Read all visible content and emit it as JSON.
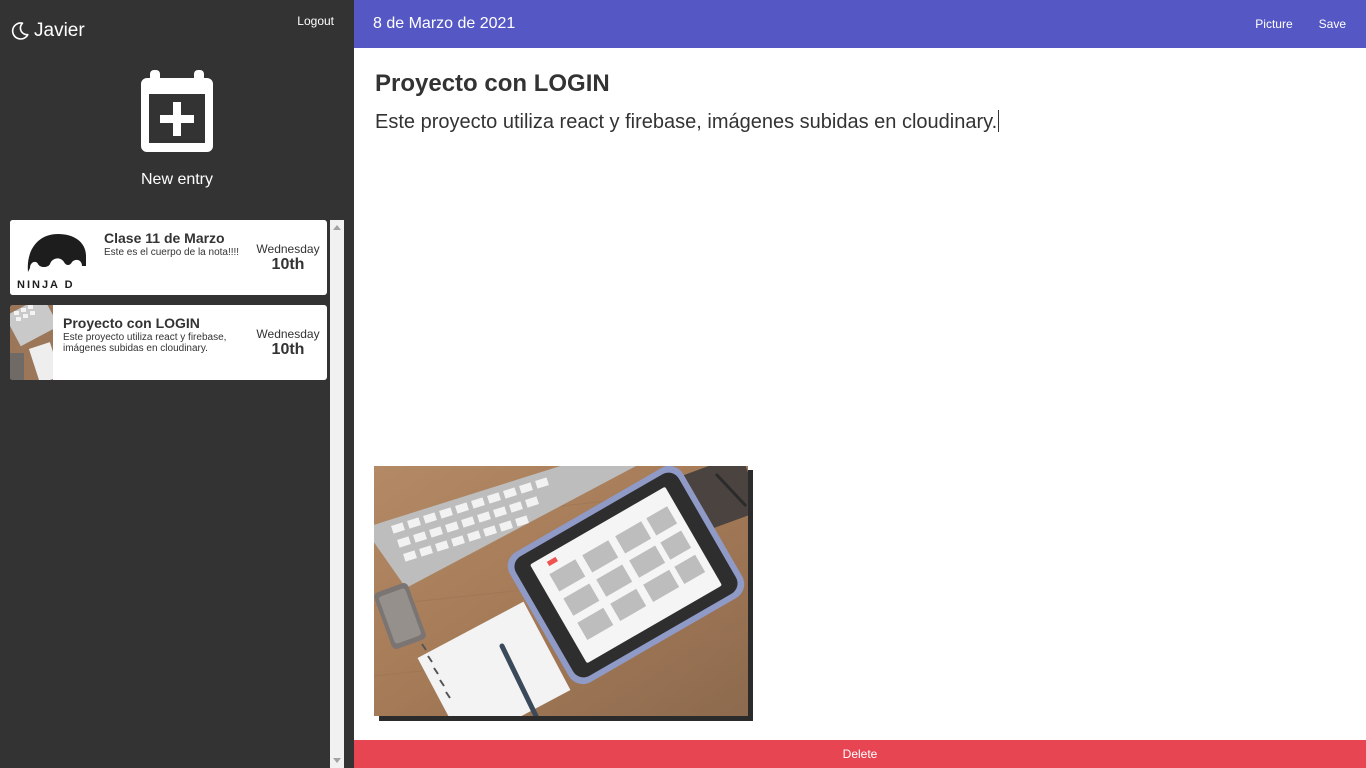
{
  "sidebar": {
    "user_name": "Javier",
    "logout_label": "Logout",
    "new_entry_label": "New entry",
    "entries": [
      {
        "title": "Clase 11 de Marzo",
        "body": "Este es el cuerpo de la nota!!!!",
        "day": "Wednesday",
        "date": "10th",
        "thumb_text": "NINJA D"
      },
      {
        "title": "Proyecto con LOGIN",
        "body": "Este proyecto utiliza react y firebase, imágenes subidas en cloudinary.",
        "day": "Wednesday",
        "date": "10th"
      }
    ]
  },
  "appbar": {
    "date": "8 de Marzo de 2021",
    "picture_label": "Picture",
    "save_label": "Save"
  },
  "note": {
    "title": "Proyecto con LOGIN",
    "body": "Este proyecto utiliza react y firebase, imágenes subidas en cloudinary."
  },
  "delete_label": "Delete",
  "colors": {
    "sidebar_bg": "#333333",
    "appbar_bg": "#5558c4",
    "delete_bg": "#e84553"
  },
  "icons": {
    "user": "moon-icon",
    "new_entry": "calendar-plus-icon"
  }
}
